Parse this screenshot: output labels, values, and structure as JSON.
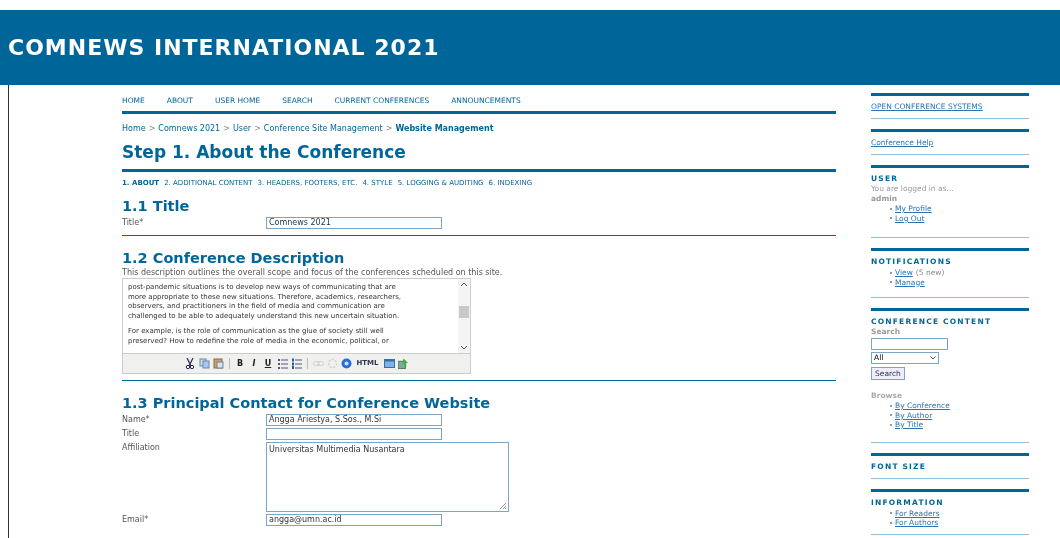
{
  "header": {
    "title": "COMNEWS INTERNATIONAL 2021"
  },
  "nav": [
    "HOME",
    "ABOUT",
    "USER HOME",
    "SEARCH",
    "CURRENT CONFERENCES",
    "ANNOUNCEMENTS"
  ],
  "breadcrumb": [
    {
      "label": "Home",
      "current": false
    },
    {
      "label": "Comnews 2021",
      "current": false
    },
    {
      "label": "User",
      "current": false
    },
    {
      "label": "Conference Site Management",
      "current": false
    },
    {
      "label": "Website Management",
      "current": true
    }
  ],
  "breadcrumb_separator": ">",
  "page_title": "Step 1. About the Conference",
  "steps": [
    {
      "label": "1. ABOUT",
      "selected": true
    },
    {
      "label": "2. ADDITIONAL CONTENT",
      "selected": false
    },
    {
      "label": "3. HEADERS, FOOTERS, ETC.",
      "selected": false
    },
    {
      "label": "4. STYLE",
      "selected": false
    },
    {
      "label": "5. LOGGING & AUDITING",
      "selected": false
    },
    {
      "label": "6. INDEXING",
      "selected": false
    }
  ],
  "sections": [
    {
      "heading": "1.1 Title",
      "fields": [
        {
          "kind": "input",
          "label": "Title*",
          "value": "Comnews 2021"
        }
      ]
    },
    {
      "heading": "1.2 Conference Description",
      "description": "This description outlines the overall scope and focus of the conferences scheduled on this site.",
      "editor": {
        "paragraphs": [
          [
            "post-pandemic situations is to develop new ways of communicating that are",
            "more appropriate to these new situations. Therefore, academics, researchers,",
            "observers, and practitioners in the field of media and communication are",
            "challenged to be able to adequately understand this new uncertain situation."
          ],
          [
            "For example, is the role of communication as the glue of society still well",
            "preserved? How to redefine the role of media in the economic, political, or"
          ]
        ],
        "toolbar": [
          {
            "kind": "cut",
            "disabled": false
          },
          {
            "kind": "copy",
            "disabled": false
          },
          {
            "kind": "paste",
            "disabled": false
          },
          {
            "kind": "separator"
          },
          {
            "kind": "bold",
            "label": "B",
            "disabled": false
          },
          {
            "kind": "italic",
            "label": "I",
            "disabled": false
          },
          {
            "kind": "underline",
            "label": "U",
            "disabled": false
          },
          {
            "kind": "bullets",
            "disabled": false
          },
          {
            "kind": "numbers",
            "disabled": false
          },
          {
            "kind": "separator"
          },
          {
            "kind": "link",
            "disabled": true
          },
          {
            "kind": "unlink",
            "disabled": true
          },
          {
            "kind": "help",
            "disabled": false
          },
          {
            "kind": "html",
            "label": "HTML",
            "disabled": false
          },
          {
            "kind": "window",
            "disabled": false
          },
          {
            "kind": "image",
            "disabled": false
          }
        ]
      }
    },
    {
      "heading": "1.3 Principal Contact for Conference Website",
      "fields": [
        {
          "kind": "input",
          "label": "Name*",
          "value": "Angga Ariestya, S.Sos., M.Si"
        },
        {
          "kind": "input",
          "label": "Title"
        },
        {
          "kind": "textarea",
          "label": "Affiliation",
          "value": "Universitas Multimedia Nusantara"
        },
        {
          "kind": "input",
          "label": "Email*",
          "value": "angga@umn.ac.id"
        }
      ]
    }
  ],
  "sidebar": [
    {
      "kind": "link",
      "link": "OPEN CONFERENCE SYSTEMS"
    },
    {
      "kind": "link",
      "link": "Conference Help"
    },
    {
      "kind": "user",
      "title": "USER",
      "note": "You are logged in as...",
      "username": "admin",
      "links": [
        {
          "label": "My Profile"
        },
        {
          "label": "Log Out"
        }
      ]
    },
    {
      "kind": "notifications",
      "title": "NOTIFICATIONS",
      "links": [
        {
          "label": "View",
          "note": "(5 new)"
        },
        {
          "label": "Manage"
        }
      ]
    },
    {
      "kind": "search",
      "title": "CONFERENCE CONTENT",
      "search_label": "Search",
      "scope": "All",
      "button": "Search",
      "browse_label": "Browse",
      "links": [
        {
          "label": "By Conference"
        },
        {
          "label": "By Author"
        },
        {
          "label": "By Title"
        }
      ]
    },
    {
      "kind": "plain",
      "title": "FONT SIZE"
    },
    {
      "kind": "list",
      "title": "INFORMATION",
      "links": [
        {
          "label": "For Readers"
        },
        {
          "label": "For Authors"
        }
      ]
    }
  ]
}
